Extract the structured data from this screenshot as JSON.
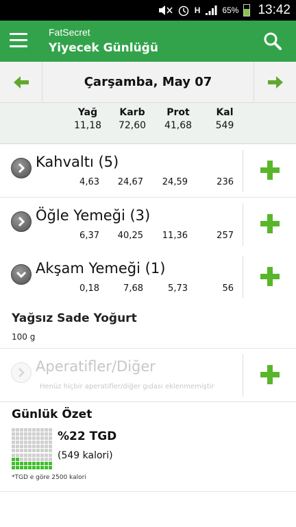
{
  "status_bar": {
    "battery": "65%",
    "time": "13:42",
    "network": "H",
    "battery_level": 0.65
  },
  "app_bar": {
    "app_name": "FatSecret",
    "title": "Yiyecek Günlüğü",
    "menu_icon": "hamburger-menu-icon",
    "search_icon": "search-icon"
  },
  "date_nav": {
    "date": "Çarşamba, May 07",
    "prev_icon": "arrow-left-icon",
    "next_icon": "arrow-right-icon"
  },
  "totals": [
    {
      "label": "Yağ",
      "value": "11,18"
    },
    {
      "label": "Karb",
      "value": "72,60"
    },
    {
      "label": "Prot",
      "value": "41,68"
    },
    {
      "label": "Kal",
      "value": "549"
    }
  ],
  "meals": [
    {
      "title": "Kahvaltı (5)",
      "values": [
        "4,63",
        "24,67",
        "24,59",
        "236"
      ],
      "expanded": false
    },
    {
      "title": "Öğle Yemeği (3)",
      "values": [
        "6,37",
        "40,25",
        "11,36",
        "257"
      ],
      "expanded": false
    },
    {
      "title": "Akşam Yemeği (1)",
      "values": [
        "0,18",
        "7,68",
        "5,73",
        "56"
      ],
      "expanded": true
    },
    {
      "title": "Aperatifler/Diğer",
      "note": "Henüz hiçbir aperatifler/diğer gıdası eklenmemiştir",
      "enabled": false
    }
  ],
  "food_item": {
    "name": "Yağsız Sade Yoğurt",
    "amount": "100 g"
  },
  "summary": {
    "title": "Günlük Özet",
    "percent": "%22 TGD",
    "calories": "(549 kalori)",
    "footnote": "*TGD e göre 2500 kalori",
    "fill_fraction": 0.22
  },
  "colors": {
    "brand_green": "#33a34b",
    "plus_green": "#58b62a",
    "grid_fill": "#3fbf2b"
  }
}
